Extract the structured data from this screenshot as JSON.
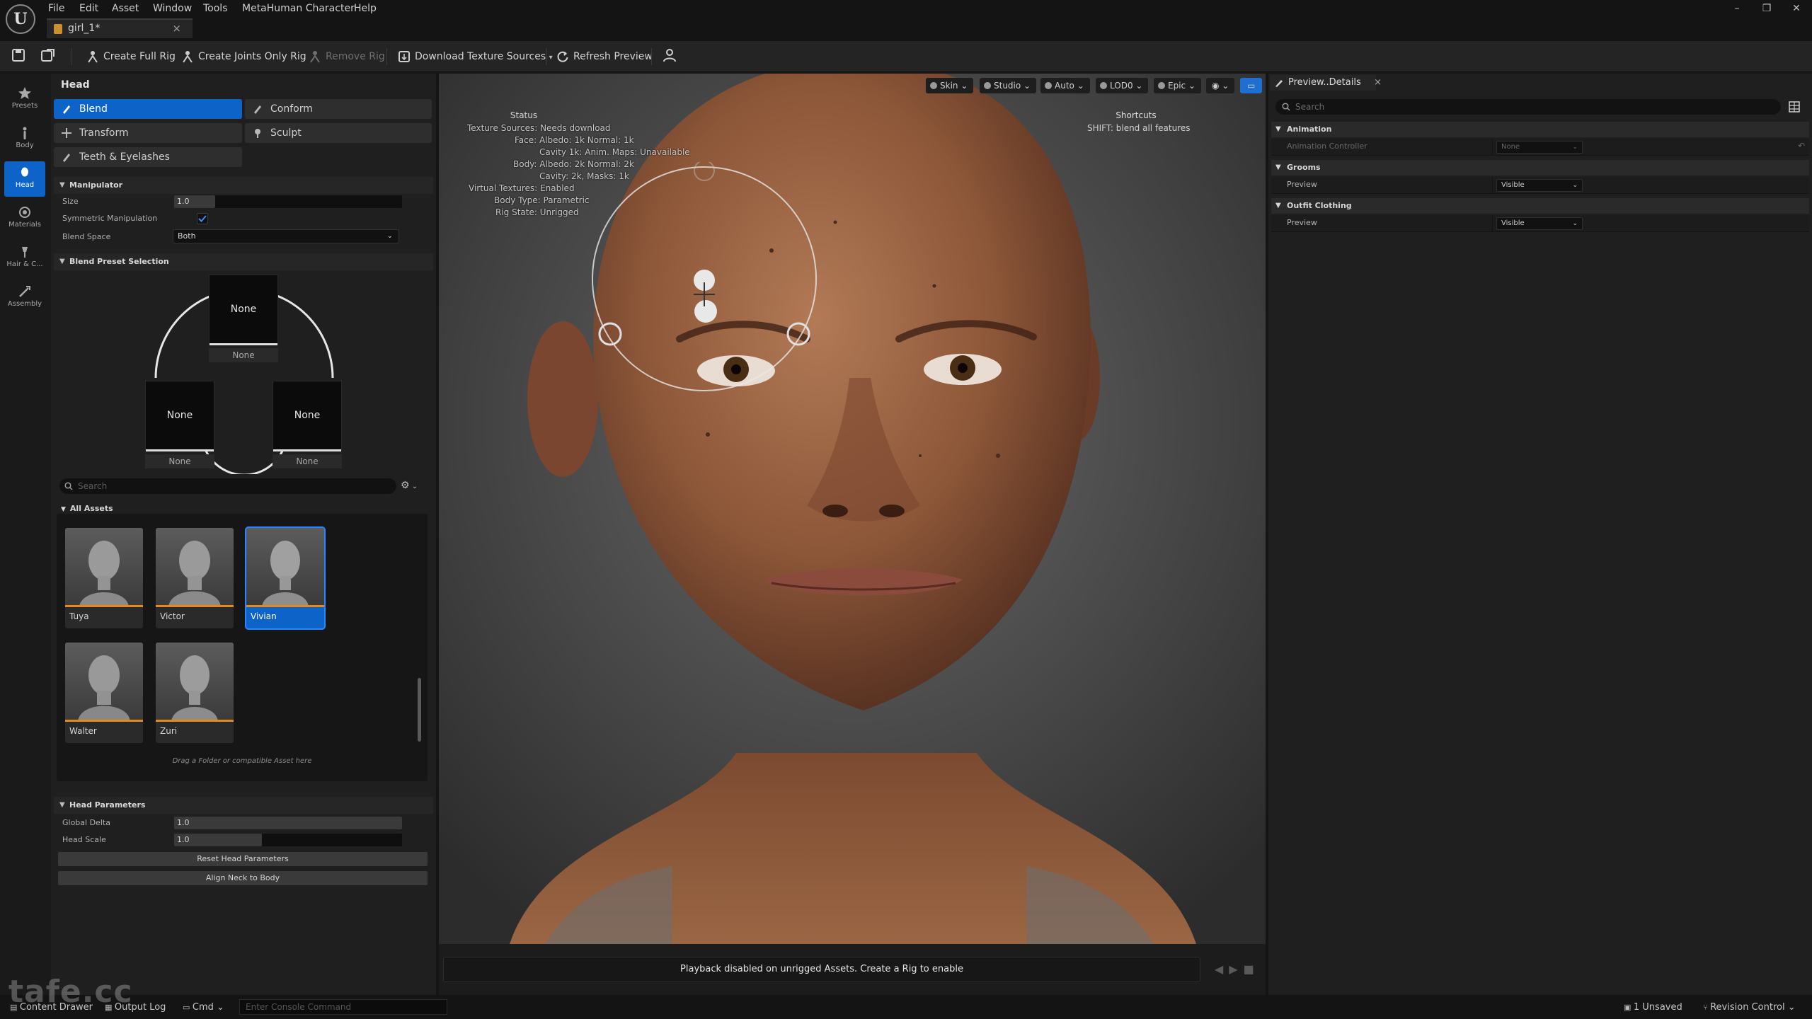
{
  "menu": [
    "File",
    "Edit",
    "Asset",
    "Window",
    "Tools",
    "MetaHuman Character",
    "Help"
  ],
  "document_tab": {
    "name": "girl_1*",
    "close": "×"
  },
  "window_controls": {
    "minimize": "–",
    "restore": "❐",
    "close": "✕"
  },
  "toolbar": {
    "create_full_rig": "Create Full Rig",
    "create_joints_only_rig": "Create Joints Only Rig",
    "remove_rig": "Remove Rig",
    "download_texture_sources": "Download Texture Sources",
    "refresh_preview": "Refresh Preview"
  },
  "rail": [
    {
      "label": "Presets",
      "icon": "star-icon"
    },
    {
      "label": "Body",
      "icon": "body-icon"
    },
    {
      "label": "Head",
      "icon": "head-icon",
      "active": true
    },
    {
      "label": "Materials",
      "icon": "materials-icon"
    },
    {
      "label": "Hair & C...",
      "icon": "hair-icon"
    },
    {
      "label": "Assembly",
      "icon": "assembly-icon"
    }
  ],
  "left_panel": {
    "title": "Head",
    "modes": {
      "blend": "Blend",
      "conform": "Conform",
      "transform": "Transform",
      "sculpt": "Sculpt",
      "teeth": "Teeth & Eyelashes"
    },
    "manipulator": {
      "header": "Manipulator",
      "size_label": "Size",
      "size_value": "1.0",
      "symmetric_label": "Symmetric Manipulation",
      "symmetric_checked": true,
      "blend_space_label": "Blend Space",
      "blend_space_value": "Both"
    },
    "blend_preset": {
      "header": "Blend Preset Selection",
      "slots": [
        {
          "card": "None",
          "label": "None"
        },
        {
          "card": "None",
          "label": "None"
        },
        {
          "card": "None",
          "label": "None"
        }
      ]
    },
    "search_placeholder": "Search",
    "all_assets_label": "All Assets",
    "assets": [
      {
        "name": "Tuya",
        "selected": false
      },
      {
        "name": "Victor",
        "selected": false
      },
      {
        "name": "Vivian",
        "selected": true
      },
      {
        "name": "Walter",
        "selected": false
      },
      {
        "name": "Zuri",
        "selected": false
      }
    ],
    "drag_hint": "Drag a Folder or compatible Asset here",
    "head_parameters": {
      "header": "Head Parameters",
      "global_delta_label": "Global Delta",
      "global_delta_value": "1.0",
      "head_scale_label": "Head Scale",
      "head_scale_value": "1.0",
      "reset_button": "Reset Head Parameters",
      "align_button": "Align Neck to Body"
    }
  },
  "viewport": {
    "chips": {
      "skin": "Skin",
      "studio": "Studio",
      "auto": "Auto",
      "lod": "LOD0",
      "epic": "Epic"
    },
    "status_title": "Status",
    "status_lines": [
      "Texture Sources: Needs download",
      "Face: Albedo: 1k Normal: 1k",
      "Cavity 1k: Anim. Maps: Unavailable",
      "Body: Albedo: 2k Normal: 2k",
      "Cavity: 2k, Masks: 1k",
      "Virtual Textures: Enabled",
      "Body Type: Parametric",
      "Rig State: Unrigged"
    ],
    "shortcuts_title": "Shortcuts",
    "shortcuts_line": "SHIFT: blend all features",
    "playback_message": "Playback disabled on unrigged Assets. Create a Rig to enable"
  },
  "right_panel": {
    "tab_label": "Preview..Details",
    "tab_close": "×",
    "search_placeholder": "Search",
    "sections": {
      "animation": "Animation",
      "animation_controller_label": "Animation Controller",
      "animation_controller_value": "None",
      "grooms": "Grooms",
      "grooms_preview_label": "Preview",
      "grooms_preview_value": "Visible",
      "outfit": "Outfit Clothing",
      "outfit_preview_label": "Preview",
      "outfit_preview_value": "Visible"
    }
  },
  "statusbar": {
    "content_drawer": "Content Drawer",
    "output_log": "Output Log",
    "cmd": "Cmd",
    "console_placeholder": "Enter Console Command",
    "unsaved": "1 Unsaved",
    "revision_control": "Revision Control"
  },
  "watermark": "tafe.cc",
  "colors": {
    "accent": "#0e63c8",
    "asset_accent": "#e28a1e",
    "panel_bg": "#1f1f1f",
    "app_bg": "#151515"
  }
}
